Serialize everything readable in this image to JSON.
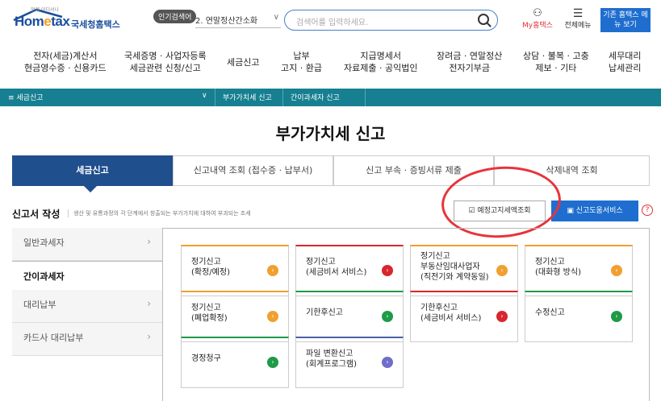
{
  "header": {
    "logo_text_1": "Hom",
    "logo_text_e": "e",
    "logo_text_2": "tax",
    "logo_kr": "국세청홈택스",
    "logo_tag": "언제 어디서나",
    "popular_badge": "인기검색어",
    "popular_value": "2. 연말정산간소화",
    "search_placeholder": "검색어를 입력하세요.",
    "mytax": "My홈택스",
    "menu": "전체메뉴",
    "prev_view": "기존 홈택스 메뉴 보기"
  },
  "nav": [
    {
      "l1": "전자(세금)계산서",
      "l2": "현금영수증 · 신용카드"
    },
    {
      "l1": "국세증명 · 사업자등록",
      "l2": "세금관련 신청/신고"
    },
    {
      "l1": "세금신고",
      "l2": ""
    },
    {
      "l1": "납부",
      "l2": "고지 · 환급"
    },
    {
      "l1": "지급명세서",
      "l2": "자료제출 · 공익법인"
    },
    {
      "l1": "장려금 · 연말정산",
      "l2": "전자기부금"
    },
    {
      "l1": "상담 · 불복 · 고충",
      "l2": "제보 · 기타"
    },
    {
      "l1": "세무대리",
      "l2": "납세관리"
    }
  ],
  "breadcrumb": {
    "menu": "≡  세금신고",
    "item1": "부가가치세 신고",
    "item2": "간이과세자 신고"
  },
  "page_title": "부가가치세 신고",
  "tabs": [
    "세금신고",
    "신고내역 조회 (접수증 · 납부서)",
    "신고 부속 · 증빙서류 제출",
    "삭제내역 조회"
  ],
  "section": {
    "title": "신고서 작성",
    "desc": "생산 및 유통과정의 각 단계에서 창출되는 부가가치에 대하여 부과되는 조세",
    "btn_prenotice": "예정고지세액조회",
    "btn_help": "신고도움서비스",
    "help_mark": "?"
  },
  "side": [
    "일반과세자",
    "간이과세자",
    "대리납부",
    "카드사 대리납부"
  ],
  "cards": [
    {
      "l1": "정기신고",
      "l2": "(확정/예정)",
      "l3": "",
      "color": "#f0a030"
    },
    {
      "l1": "정기신고",
      "l2": "(세금비서 서비스)",
      "l3": "",
      "color": "#d9252e"
    },
    {
      "l1": "정기신고",
      "l2": "부동산임대사업자",
      "l3": "(직전기와 계약동일)",
      "color": "#f0a030"
    },
    {
      "l1": "정기신고",
      "l2": "(대화형 방식)",
      "l3": "",
      "color": "#f0a030"
    },
    {
      "l1": "정기신고",
      "l2": "(폐업확정)",
      "l3": "",
      "color": "#f0a030"
    },
    {
      "l1": "기한후신고",
      "l2": "",
      "l3": "",
      "color": "#1f9a48"
    },
    {
      "l1": "기한후신고",
      "l2": "(세금비서 서비스)",
      "l3": "",
      "color": "#d9252e"
    },
    {
      "l1": "수정신고",
      "l2": "",
      "l3": "",
      "color": "#1f9a48"
    },
    {
      "l1": "경정청구",
      "l2": "",
      "l3": "",
      "color": "#1f9a48"
    },
    {
      "l1": "파일 변환신고",
      "l2": "(회계프로그램)",
      "l3": "",
      "color": "#4d5fa8"
    }
  ]
}
